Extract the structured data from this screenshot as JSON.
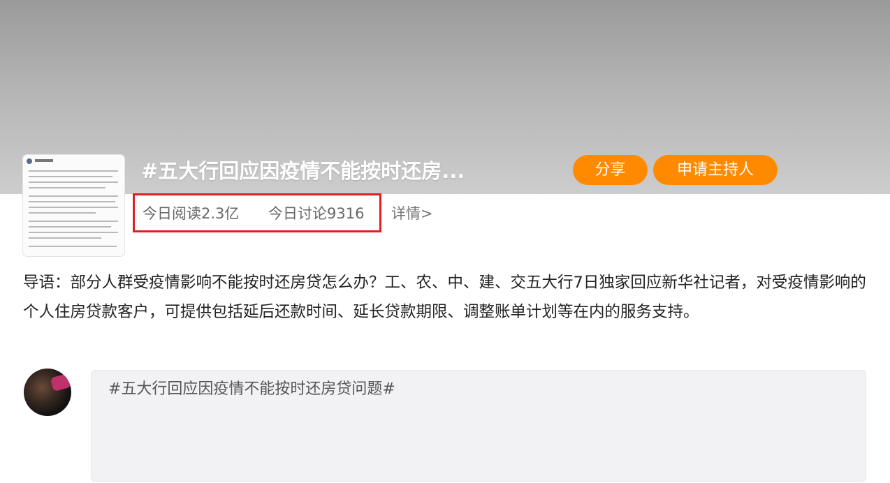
{
  "topic": {
    "title": "#五大行回应因疫情不能按时还房..."
  },
  "actions": {
    "share_label": "分享",
    "apply_host_label": "申请主持人"
  },
  "stats": {
    "read_today": "今日阅读2.3亿",
    "discuss_today": "今日讨论9316",
    "detail_link": "详情>"
  },
  "intro": {
    "text": "导语：部分人群受疫情影响不能按时还房贷怎么办？工、农、中、建、交五大行7日独家回应新华社记者，对受疫情影响的个人住房贷款客户，可提供包括延后还款时间、延长贷款期限、调整账单计划等在内的服务支持。"
  },
  "composer": {
    "text": "#五大行回应因疫情不能按时还房贷问题#"
  },
  "colors": {
    "accent": "#ff8a00",
    "highlight_border": "#e02020"
  }
}
